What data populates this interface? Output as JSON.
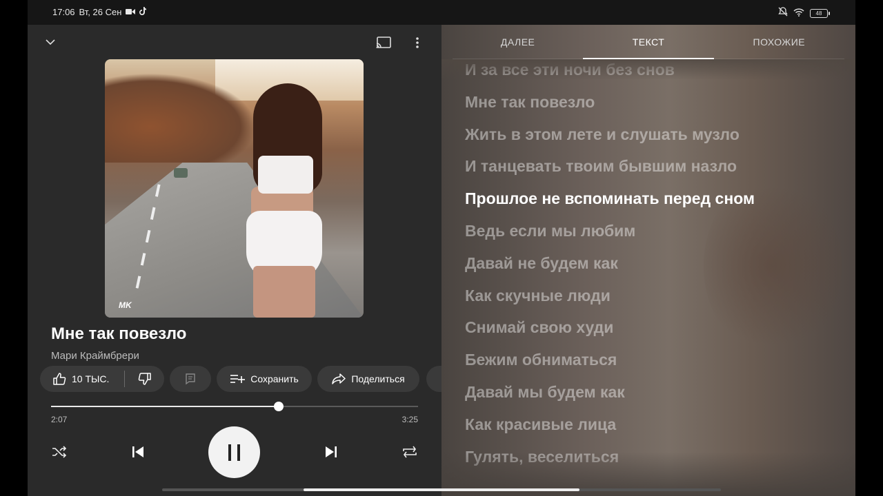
{
  "status": {
    "time": "17:06",
    "date": "Вт, 26 Сен",
    "battery": "48"
  },
  "player": {
    "track_title": "Мне так повезло",
    "artist": "Мари Краймбрери",
    "cover_watermark": "MK",
    "likes": "10 ТЫС.",
    "save_label": "Сохранить",
    "share_label": "Поделиться",
    "current_time": "2:07",
    "total_time": "3:25",
    "progress": 0.62
  },
  "tabs": [
    {
      "label": "ДАЛЕЕ",
      "active": false
    },
    {
      "label": "ТЕКСТ",
      "active": true
    },
    {
      "label": "ПОХОЖИЕ",
      "active": false
    }
  ],
  "lyrics": {
    "current_index": 4,
    "lines": [
      "И за все эти ночи без снов",
      "Мне так повезло",
      "Жить в этом лете и слушать музло",
      "И танцевать твоим бывшим назло",
      "Прошлое не вспоминать перед сном",
      "Ведь если мы любим",
      "Давай не будем как",
      "Как скучные люди",
      "Снимай свою худи",
      "Бежим обниматься",
      "Давай мы будем как",
      "Как красивые лица",
      "Гулять, веселиться"
    ]
  },
  "colors": {
    "accent": "#ffffff",
    "chip_bg": "#3a3a3a",
    "pane_bg": "#2a2a2a"
  }
}
